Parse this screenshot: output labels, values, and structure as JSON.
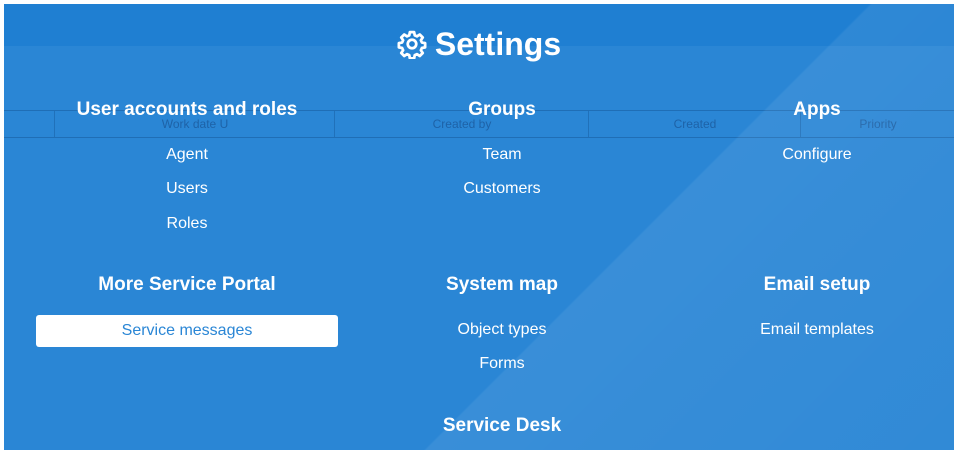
{
  "header": {
    "title": "Settings",
    "icon": "gear-icon"
  },
  "background_table": {
    "columns": [
      "Work date U",
      "Created by",
      "Created",
      "Priority"
    ]
  },
  "sections": {
    "user_accounts": {
      "heading": "User accounts and roles",
      "links": [
        "Agent",
        "Users",
        "Roles"
      ]
    },
    "groups": {
      "heading": "Groups",
      "links": [
        "Team",
        "Customers"
      ]
    },
    "apps": {
      "heading": "Apps",
      "links": [
        "Configure"
      ]
    },
    "more_service_portal": {
      "heading": "More Service Portal",
      "links": [
        "Service messages"
      ]
    },
    "system_map": {
      "heading": "System map",
      "links": [
        "Object types",
        "Forms"
      ]
    },
    "email_setup": {
      "heading": "Email setup",
      "links": [
        "Email templates"
      ]
    },
    "service_desk": {
      "heading": "Service Desk"
    }
  },
  "colors": {
    "overlay_blue": "#2a86d5",
    "header_blue": "#1f7fd2",
    "text": "#ffffff"
  }
}
